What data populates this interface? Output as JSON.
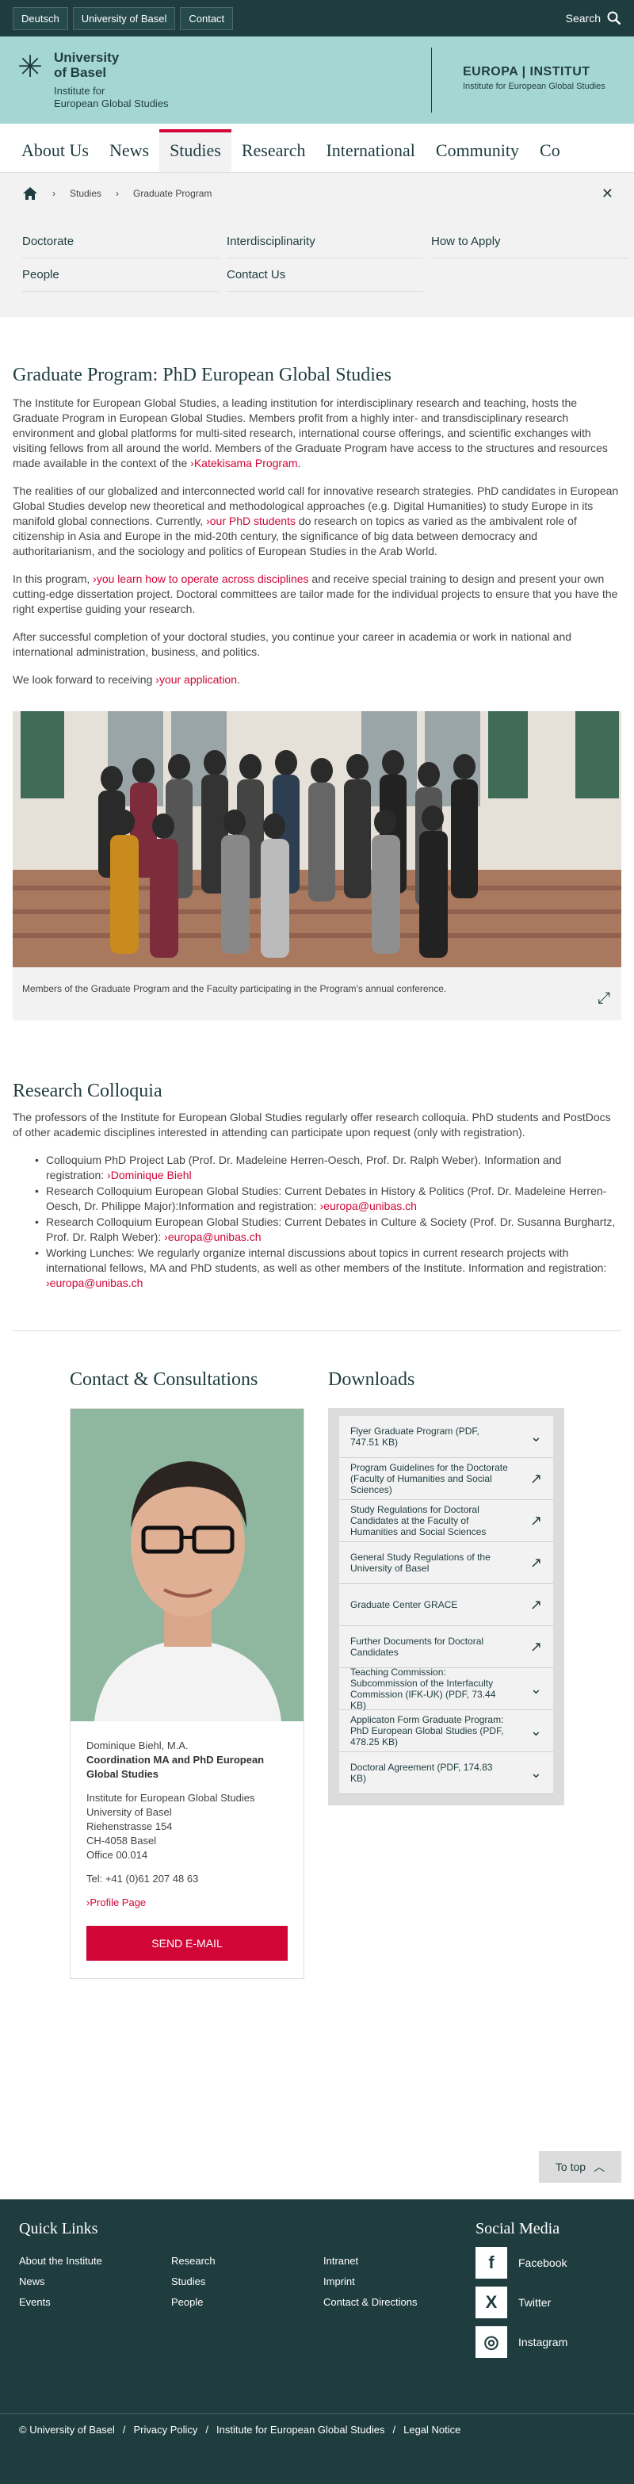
{
  "top": {
    "lang": "Deutsch",
    "uni": "University of Basel",
    "contact": "Contact",
    "search": "Search"
  },
  "brand": {
    "uni_line1": "University",
    "uni_line2": "of Basel",
    "inst_line1": "Institute for",
    "inst_line2": "European Global Studies",
    "europa_title": "EUROPA | INSTITUT",
    "europa_sub": "Institute for European Global Studies"
  },
  "nav": [
    "About Us",
    "News",
    "Studies",
    "Research",
    "International",
    "Community",
    "Co"
  ],
  "breadcrumb": {
    "items": [
      "Studies",
      "Graduate Program"
    ]
  },
  "subnav": [
    "Doctorate",
    "Interdisciplinarity",
    "How to Apply",
    "People",
    "Contact Us"
  ],
  "main": {
    "title": "Graduate Program: PhD European Global Studies",
    "p1": "The Institute for European Global Studies, a leading institution for interdisciplinary research and teaching, hosts the Graduate Program in European Global Studies. Members profit from a highly inter- and transdisciplinary research environment and global platforms for multi-sited research, international course offerings, and scientific exchanges with visiting fellows from all around the world. Members of the Graduate Program have access to the structures and resources made available in the context of the ",
    "p1_link": "Katekisama Program",
    "p2a": "The realities of our globalized and interconnected world call for innovative research strategies. PhD candidates in European Global Studies develop new theoretical and methodological approaches (e.g. Digital Humanities) to study Europe in its manifold global connections. Currently, ",
    "p2_link": "our PhD students",
    "p2b": " do research on topics as varied as the ambivalent role of citizenship in Asia and Europe in the mid-20th century, the significance of big data between democracy and authoritarianism, and the sociology and politics of European Studies in the Arab World.",
    "p3a": "In this program, ",
    "p3_link": "you learn how to operate across disciplines",
    "p3b": " and receive special training to design and present your own cutting-edge dissertation project. Doctoral committees are tailor made for the individual projects to ensure that you have the right expertise guiding your research.",
    "p4": "After successful completion of your doctoral studies, you continue your career in academia or work in national and international administration, business, and politics.",
    "p5a": "We look forward to receiving ",
    "p5_link": "your application",
    "photo_caption": "Members of the Graduate Program and the Faculty participating in the Program's annual conference."
  },
  "colloquia": {
    "title": "Research Colloquia",
    "intro": "The professors of the Institute for European Global Studies regularly offer research colloquia. PhD students and PostDocs of other academic disciplines interested in attending can participate upon request (only with registration).",
    "items": [
      {
        "text": "Colloquium PhD Project Lab (Prof. Dr. Madeleine Herren-Oesch, Prof. Dr. Ralph Weber). Information and registration: ",
        "link": "Dominique Biehl"
      },
      {
        "text": "Research Colloquium European Global Studies: Current Debates in History & Politics (Prof. Dr. Madeleine Herren-Oesch, Dr. Philippe Major):Information and registration: ",
        "link": "europa@unibas.ch"
      },
      {
        "text": "Research Colloquium European Global Studies: Current Debates in Culture & Society (Prof. Dr. Susanna Burghartz, Prof. Dr. Ralph Weber): ",
        "link": "europa@unibas.ch"
      },
      {
        "text": "Working Lunches: We regularly organize internal discussions about topics in current research projects with international fellows, MA and PhD students, as well as other members of the Institute. Information and registration: ",
        "link": "europa@unibas.ch"
      }
    ]
  },
  "contact": {
    "title": "Contact & Consultations",
    "name": "Dominique Biehl, M.A.",
    "role": "Coordination MA and PhD European Global Studies",
    "address": [
      "Institute for European Global Studies",
      "University of Basel",
      "Riehenstrasse 154",
      "CH-4058 Basel",
      "Office 00.014"
    ],
    "tel": "Tel: +41 (0)61 207 48 63",
    "profile": "Profile Page",
    "send": "SEND E-MAIL"
  },
  "downloads": {
    "title": "Downloads",
    "items": [
      {
        "label": "Flyer Graduate Program (PDF, 747.51 KB)",
        "icon": "download-icon"
      },
      {
        "label": "Program Guidelines for the Doctorate (Faculty of Humanities and Social Sciences)",
        "icon": "external-link-icon"
      },
      {
        "label": "Study Regulations for Doctoral Candidates at the Faculty of Humanities and Social Sciences",
        "icon": "external-link-icon"
      },
      {
        "label": "General Study Regulations of the University of Basel",
        "icon": "external-link-icon"
      },
      {
        "label": "Graduate Center GRACE",
        "icon": "external-link-icon"
      },
      {
        "label": "Further Documents for Doctoral Candidates",
        "icon": "external-link-icon"
      },
      {
        "label": "Teaching Commission: Subcommission of the Interfaculty Commission (IFK-UK) (PDF, 73.44 KB)",
        "icon": "download-icon"
      },
      {
        "label": "Applicaton Form Graduate Program: PhD European Global Studies (PDF, 478.25 KB)",
        "icon": "download-icon"
      },
      {
        "label": "Doctoral Agreement (PDF, 174.83 KB)",
        "icon": "download-icon"
      }
    ]
  },
  "totop": "To top",
  "footer": {
    "quick_title": "Quick Links",
    "links": [
      "About the Institute",
      "Research",
      "Intranet",
      "News",
      "Studies",
      "Imprint",
      "Events",
      "People",
      "Contact & Directions"
    ],
    "social_title": "Social Media",
    "social": [
      {
        "label": "Facebook",
        "glyph": "f"
      },
      {
        "label": "Twitter",
        "glyph": "X"
      },
      {
        "label": "Instagram",
        "glyph": "◎"
      }
    ],
    "bottom": [
      "© University of Basel",
      "Privacy Policy",
      "Institute for European Global Studies",
      "Legal Notice"
    ]
  }
}
